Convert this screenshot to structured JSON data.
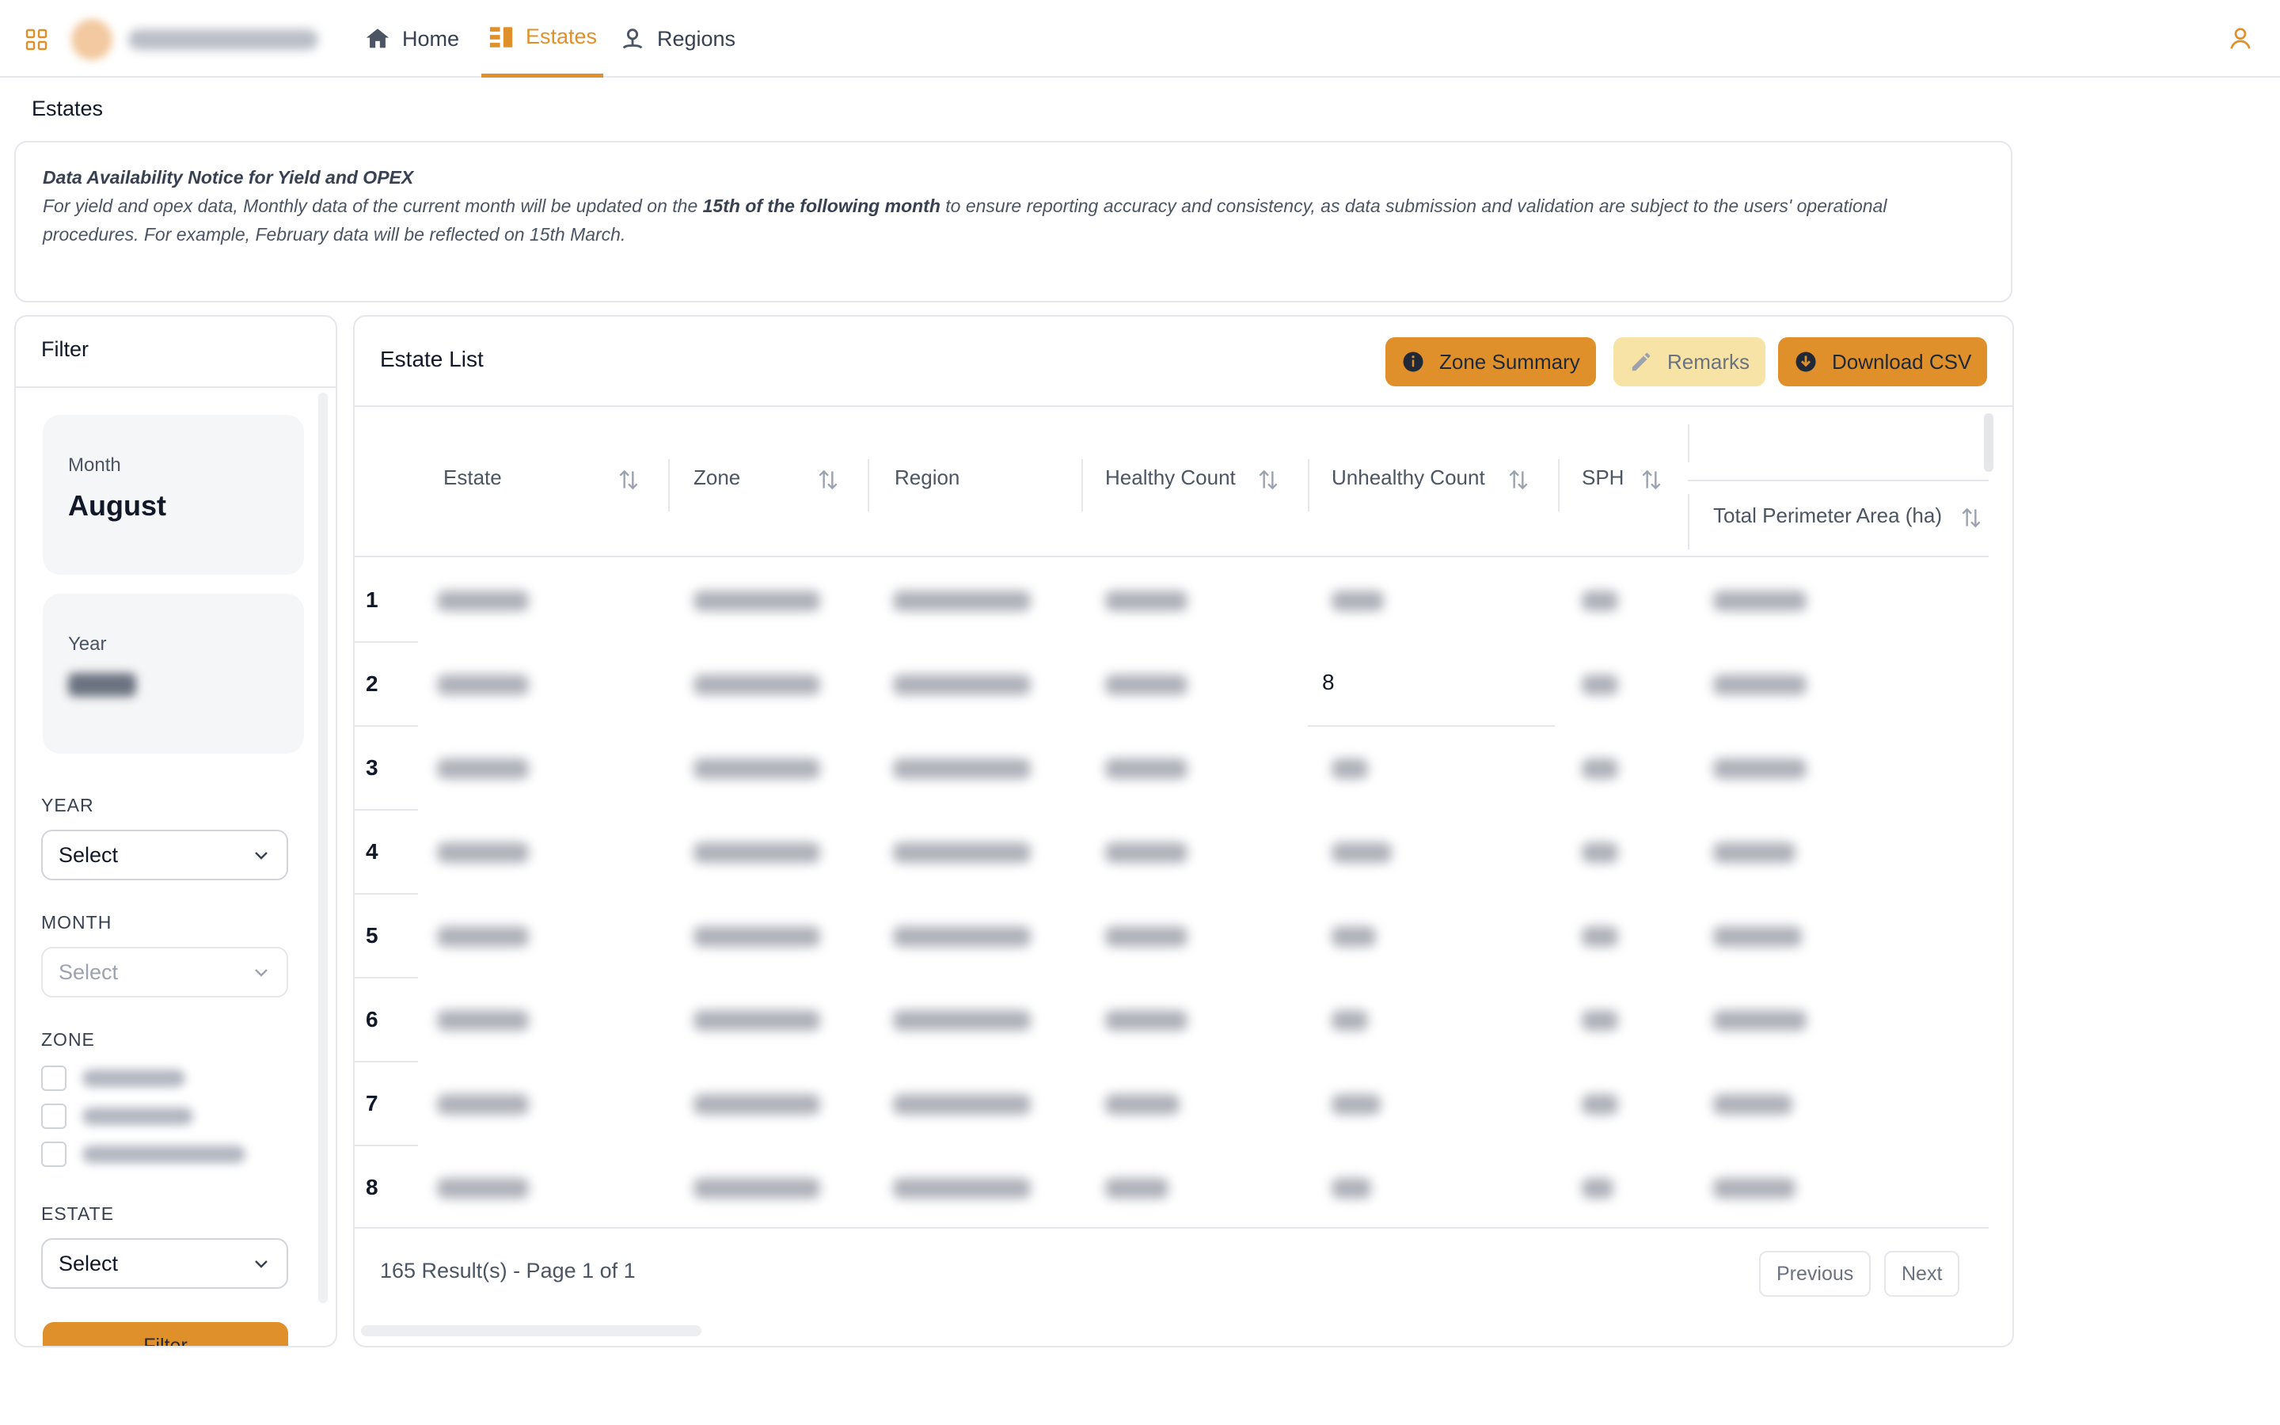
{
  "nav": {
    "items": [
      {
        "label": "Home",
        "icon": "home-icon"
      },
      {
        "label": "Estates",
        "icon": "estates-icon",
        "active": true
      },
      {
        "label": "Regions",
        "icon": "regions-icon"
      }
    ]
  },
  "page": {
    "title": "Estates"
  },
  "notice": {
    "title": "Data Availability Notice for Yield and OPEX",
    "text_before": "For yield and opex data, Monthly data of the current month will be updated on the ",
    "text_bold": "15th of the following month",
    "text_after": " to ensure reporting accuracy and consistency, as data submission and validation are subject to the users' operational procedures. For example, February data will be reflected on 15th March."
  },
  "filter": {
    "title": "Filter",
    "month_card": {
      "label": "Month",
      "value": "August"
    },
    "year_card": {
      "label": "Year"
    },
    "year_label": "YEAR",
    "year_select": "Select",
    "month_label": "MONTH",
    "month_select": "Select",
    "zone_label": "ZONE",
    "estate_label": "ESTATE",
    "estate_select": "Select",
    "button": "Filter"
  },
  "list": {
    "title": "Estate List",
    "buttons": {
      "zone_summary": "Zone Summary",
      "remarks": "Remarks",
      "download": "Download CSV"
    },
    "columns": {
      "estate": "Estate",
      "zone": "Zone",
      "region": "Region",
      "healthy": "Healthy Count",
      "unhealthy": "Unhealthy Count",
      "sph": "SPH",
      "perimeter": "Total Perimeter Area (ha)"
    },
    "row_numbers": [
      "1",
      "2",
      "3",
      "4",
      "5",
      "6",
      "7",
      "8"
    ],
    "edited_cell_value": "8",
    "results_text": "165 Result(s) - Page 1 of 1",
    "prev": "Previous",
    "next": "Next"
  },
  "colors": {
    "accent": "#e0902a",
    "remarks_bg": "#f8e3a6"
  }
}
